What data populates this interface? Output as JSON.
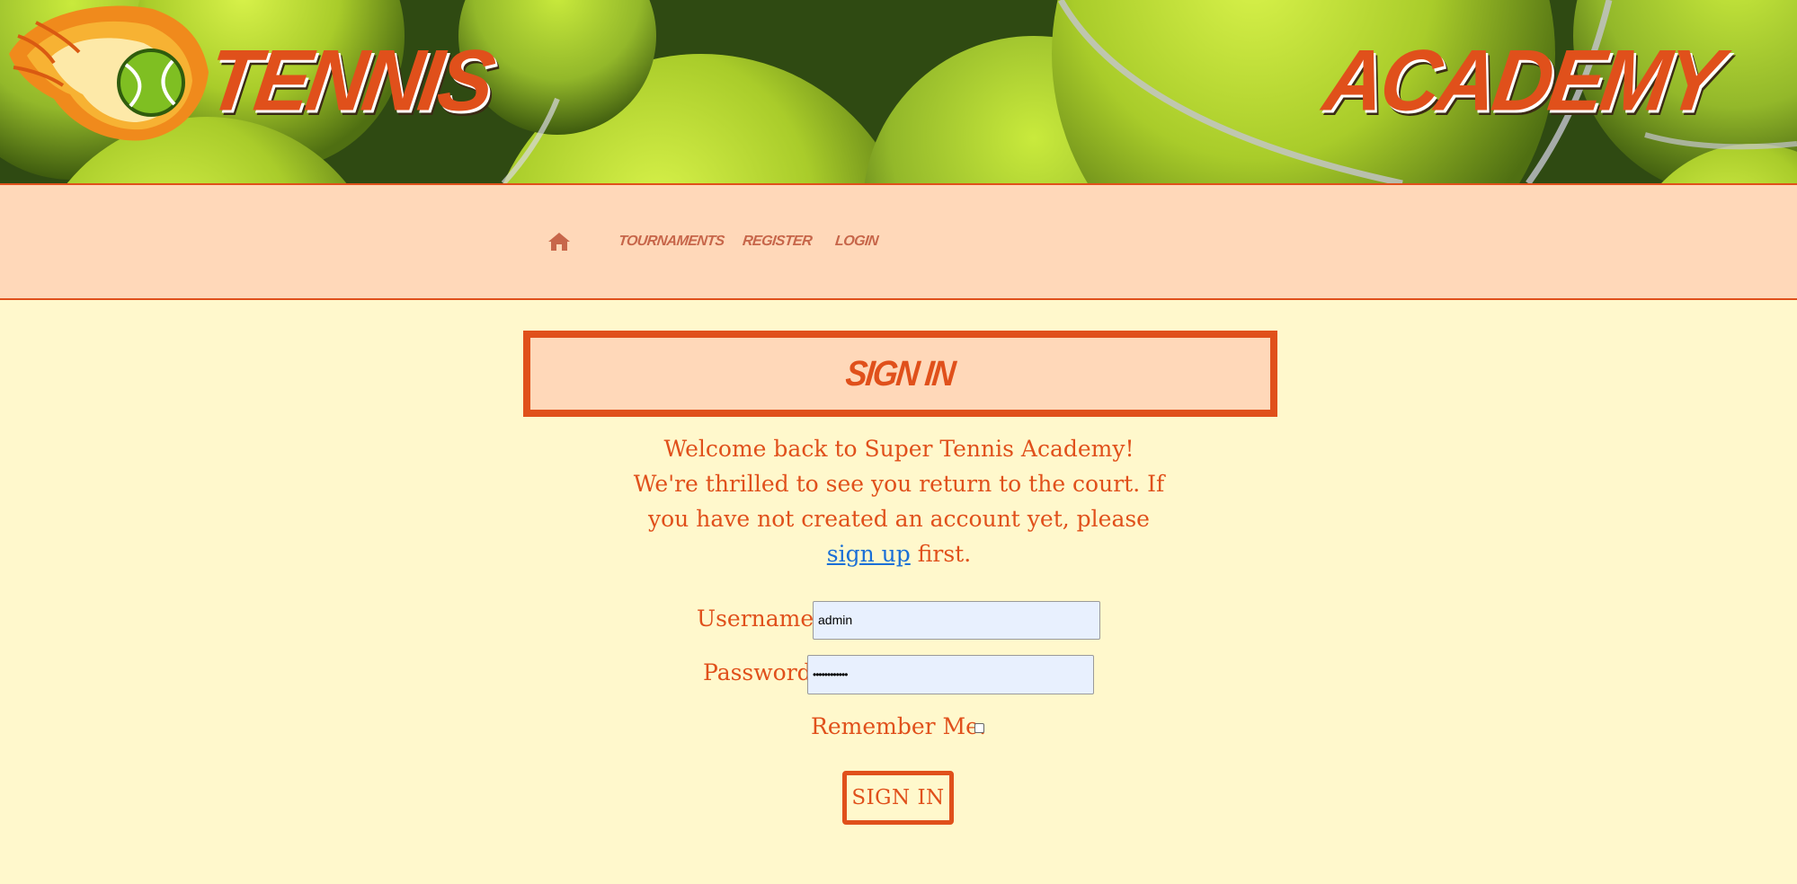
{
  "header": {
    "brand_left": "TENNIS",
    "brand_right": "ACADEMY"
  },
  "nav": {
    "home_icon": "home-icon",
    "items": [
      {
        "label": "TOURNAMENTS"
      },
      {
        "label": "REGISTER"
      },
      {
        "label": "LOGIN"
      }
    ]
  },
  "page": {
    "title": "SIGN IN",
    "welcome_text": "Welcome back to Super Tennis Academy! We're thrilled to see you return to the court. If you have not created an account yet, please",
    "signup_link": "sign up",
    "welcome_suffix": " first."
  },
  "form": {
    "username_label": "Username:",
    "username_value": "admin",
    "password_label": "Password:",
    "password_value": "••••••••••••",
    "remember_label": "Remember Me:",
    "remember_checked": false,
    "submit_label": "SIGN IN"
  },
  "colors": {
    "accent": "#e0501b",
    "nav_bg": "#ffd8b9",
    "page_bg": "#fff8cc",
    "link": "#1a6fd6"
  }
}
